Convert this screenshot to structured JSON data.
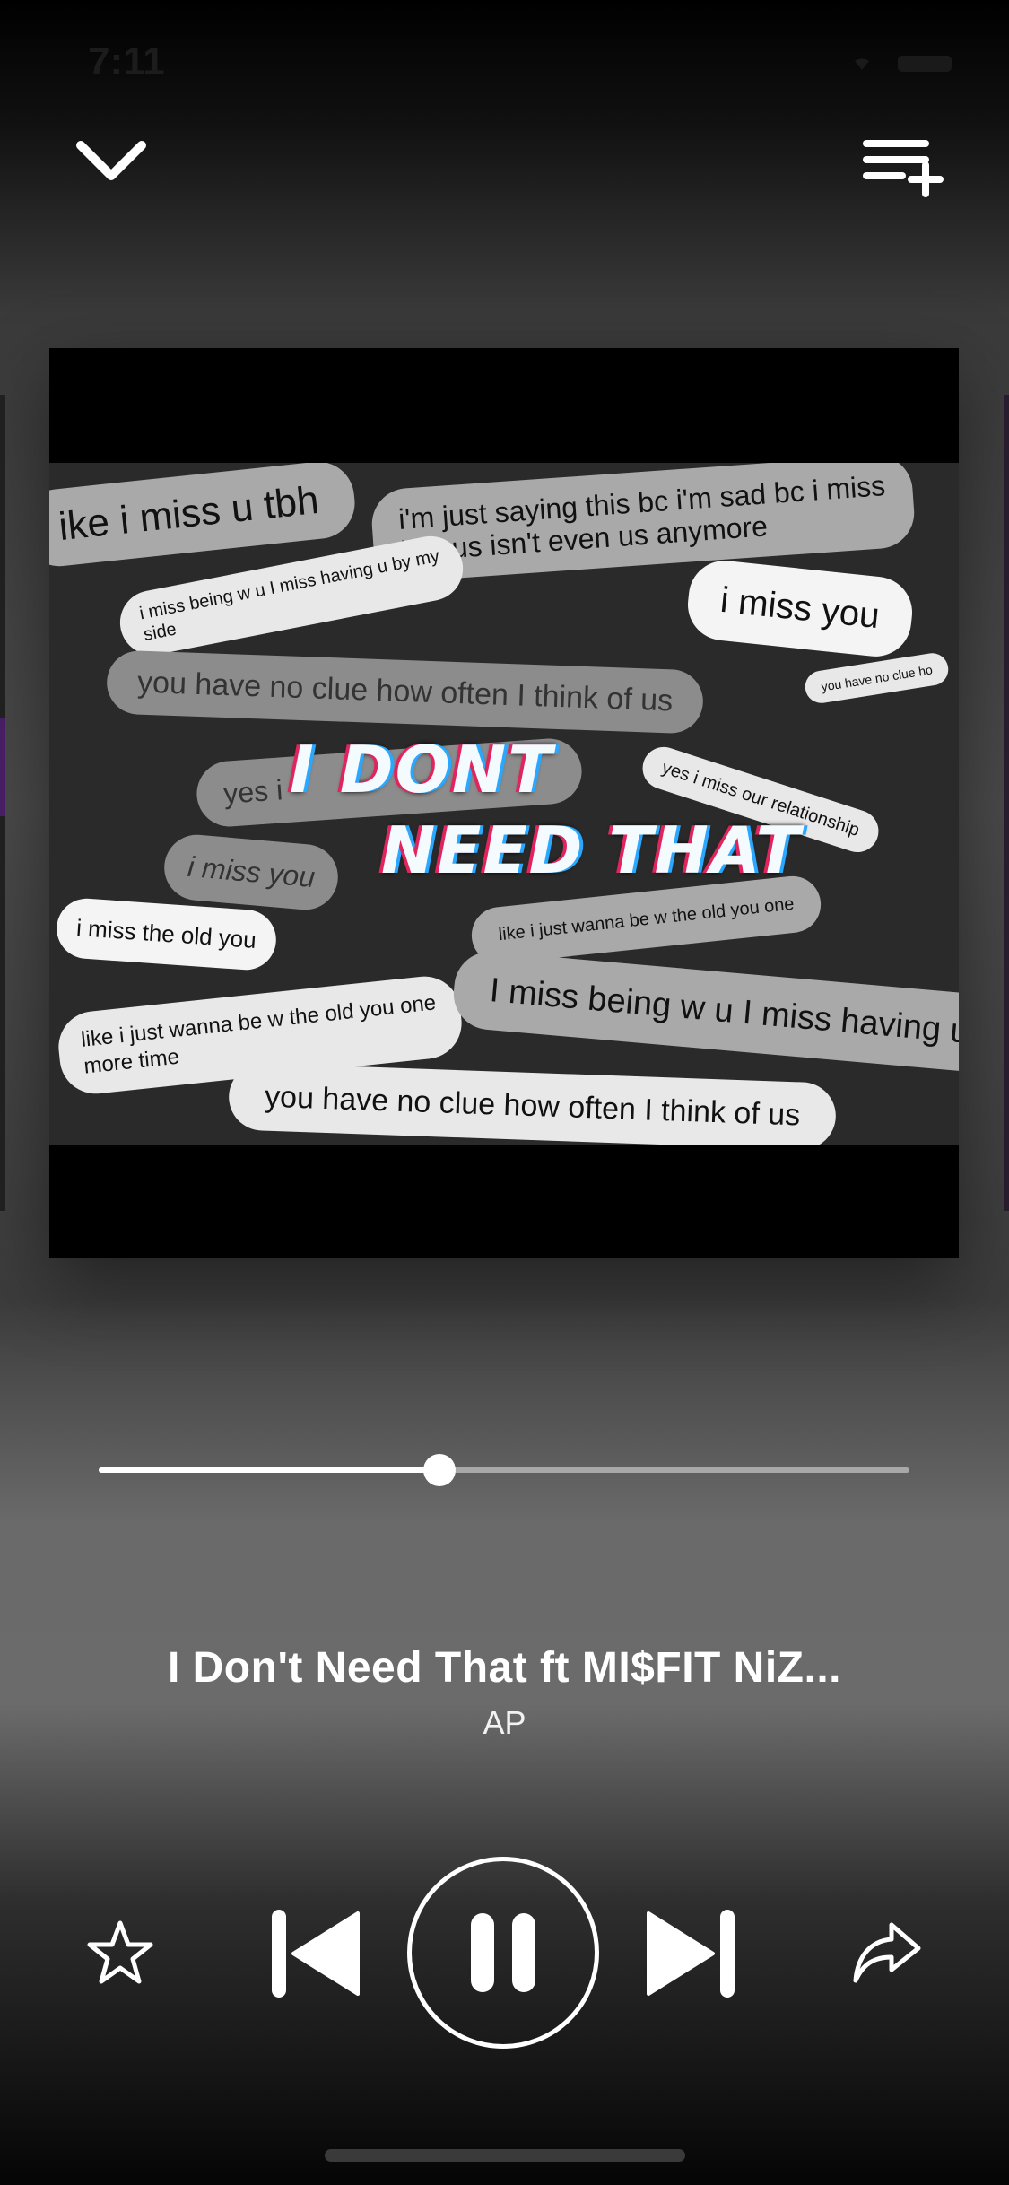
{
  "status_bar": {
    "time": "7:11"
  },
  "header": {
    "collapse_icon": "chevron-down-icon",
    "queue_icon": "add-to-queue-icon"
  },
  "album_art": {
    "bubbles": [
      "ike i miss u tbh",
      "i'm just saying this bc i'm sad bc i miss\nlike us isn't even us anymore",
      "i miss being w u I miss having u by my\nside",
      "i miss you",
      "you have no clue how often I think of us",
      "you have no clue ho",
      "yes i",
      "yes i miss our relationship",
      "i miss you",
      "i miss the old you",
      "like i just wanna be w the old you one",
      "I miss being w u I miss having u by",
      "side",
      "like i just wanna be w the old you one\nmore time",
      "you have no clue how often I think of us"
    ],
    "title_line_1": "I DONT",
    "title_line_2": "NEED THAT"
  },
  "playback": {
    "progress": 0.42
  },
  "track": {
    "title": "I Don't Need That ft MI$FIT NiZ...",
    "artist": "AP"
  },
  "controls": {
    "favorite_icon": "star-icon",
    "previous_icon": "skip-previous-icon",
    "pause_icon": "pause-icon",
    "next_icon": "skip-next-icon",
    "share_icon": "share-icon"
  }
}
